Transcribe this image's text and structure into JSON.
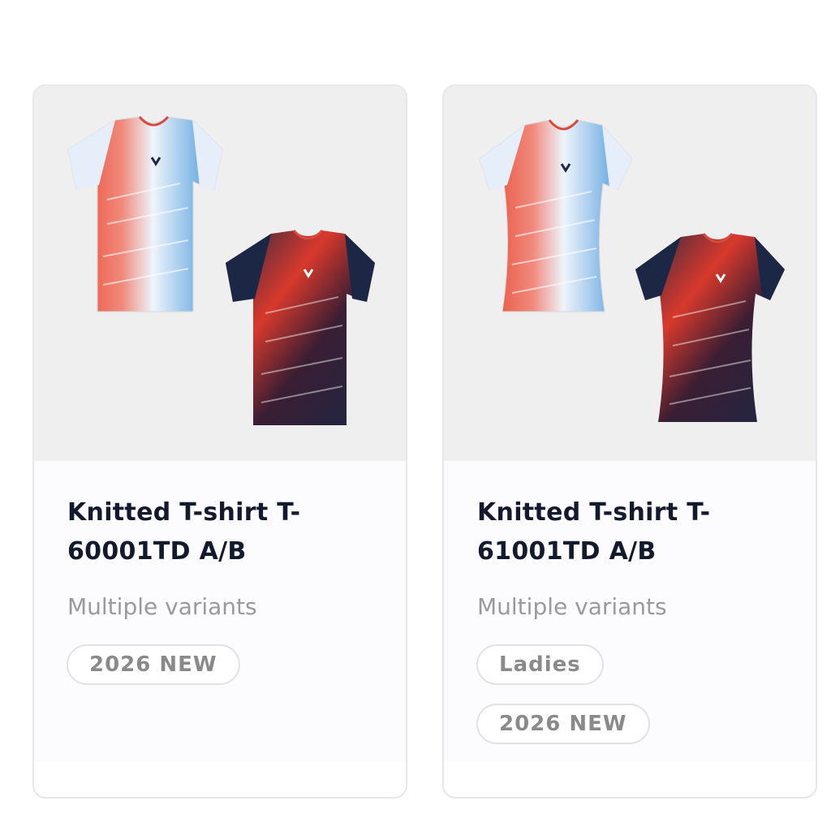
{
  "products": [
    {
      "title_line1": "Knitted T-shirt T-",
      "title_line2": "60001TD A/B",
      "subtitle": "Multiple variants",
      "badges": [
        "2026 NEW"
      ],
      "image_alt": "t-shirt-pair-unisex"
    },
    {
      "title_line1": "Knitted T-shirt T-",
      "title_line2": "61001TD A/B",
      "subtitle": "Multiple variants",
      "badges": [
        "Ladies",
        "2026 NEW"
      ],
      "image_alt": "t-shirt-pair-ladies"
    }
  ],
  "colors": {
    "image_bg": "#efefef",
    "title": "#141a2e",
    "muted": "#9a9a9a",
    "shirt_red": "#e8432f",
    "shirt_blue": "#3a8fd8",
    "shirt_navy": "#1c2745",
    "shirt_light": "#dce9f7"
  }
}
